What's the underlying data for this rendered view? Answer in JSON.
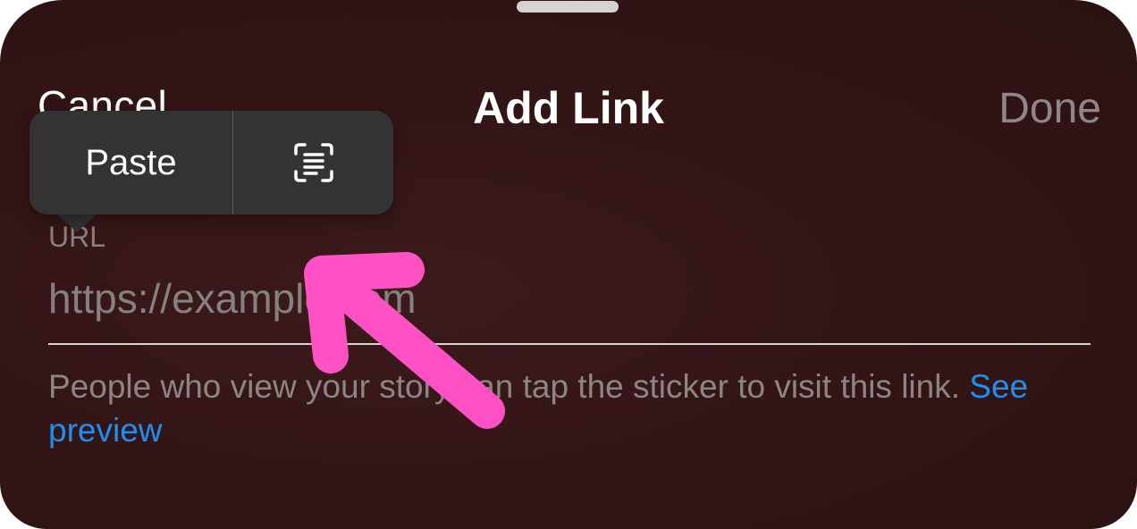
{
  "sheet": {
    "background": "#341516"
  },
  "nav": {
    "cancel_label": "Cancel",
    "title": "Add Link",
    "done_label": "Done"
  },
  "context_menu": {
    "paste_label": "Paste",
    "scan_icon": "scan-text-icon"
  },
  "form": {
    "field_label": "URL",
    "url_value": "",
    "url_placeholder": "https://example.com",
    "helper_text": "People who view your story can tap the sticker to visit this link.",
    "helper_link": "See preview"
  },
  "annotation": {
    "icon": "pointer-arrow-icon",
    "color": "#ff50c4"
  },
  "colors": {
    "link_blue": "#1c8ff0",
    "done_gray": "#8f8687"
  }
}
